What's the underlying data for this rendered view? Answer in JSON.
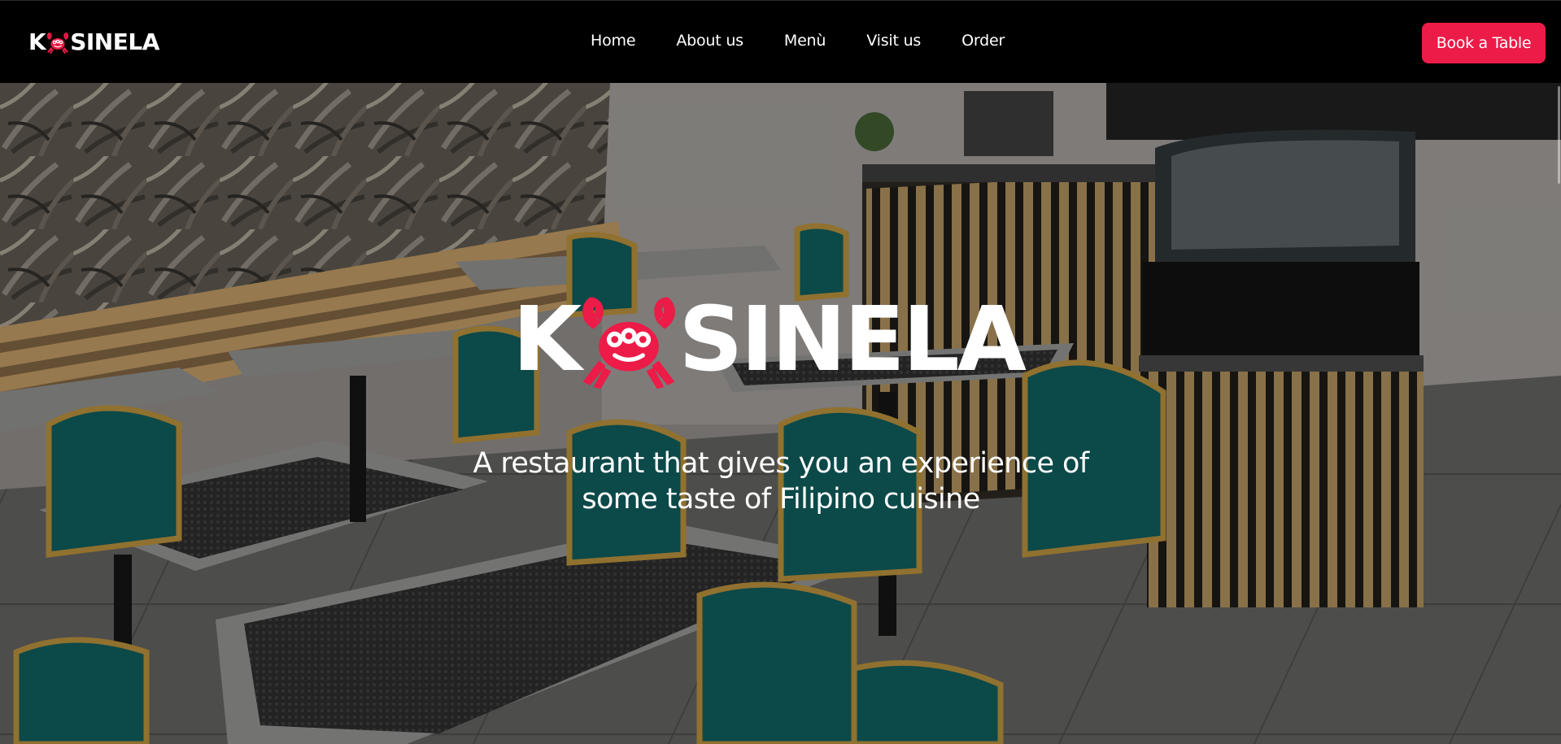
{
  "header": {
    "brand": {
      "letters_before": "K",
      "letters_after": "SINELA",
      "crab_icon": "crab-icon"
    },
    "nav": [
      {
        "label": "Home"
      },
      {
        "label": "About us"
      },
      {
        "label": "Menù"
      },
      {
        "label": "Visit us"
      },
      {
        "label": "Order"
      }
    ],
    "book_button": "Book a Table"
  },
  "hero": {
    "logo": {
      "letters_before": "K",
      "letters_after": "SINELA",
      "crab_icon": "crab-icon"
    },
    "tagline_line1": "A restaurant that gives you an experience of",
    "tagline_line2": "some taste of Filipino cuisine",
    "background_image": "restaurant-interior-photo"
  },
  "colors": {
    "accent": "#ed1b47",
    "header_bg": "#000000",
    "text": "#ffffff",
    "chair_teal": "#0f5a5a",
    "wood": "#b89460"
  }
}
